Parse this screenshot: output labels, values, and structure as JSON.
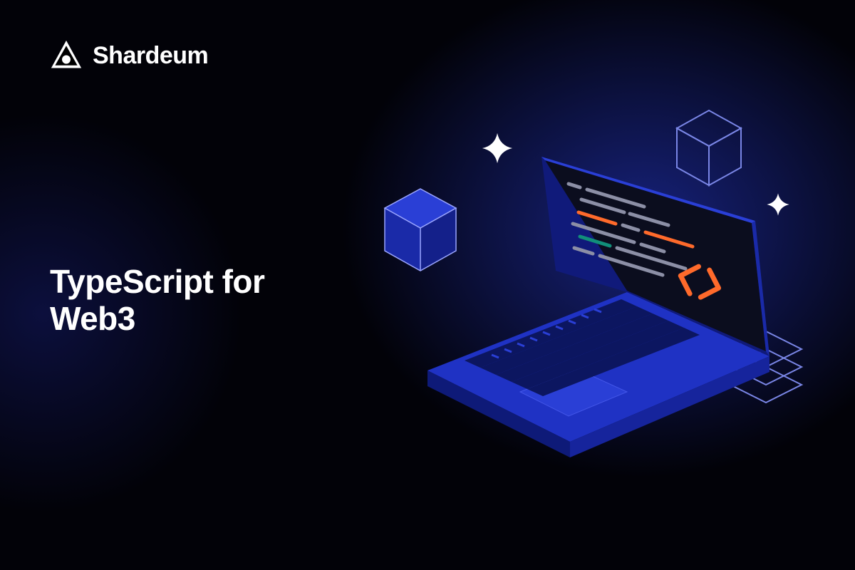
{
  "brand": {
    "name": "Shardeum"
  },
  "heading": {
    "line1": "TypeScript for",
    "line2": "Web3"
  },
  "colors": {
    "accent_orange": "#ff6a2b",
    "accent_teal": "#118f7a",
    "code_dim": "#8c8fa6",
    "laptop_body": "#2a3fd6",
    "laptop_body_dark": "#1a2aa8",
    "screen_bg": "#0b0d1e",
    "cube_stroke": "#7a86e6"
  }
}
